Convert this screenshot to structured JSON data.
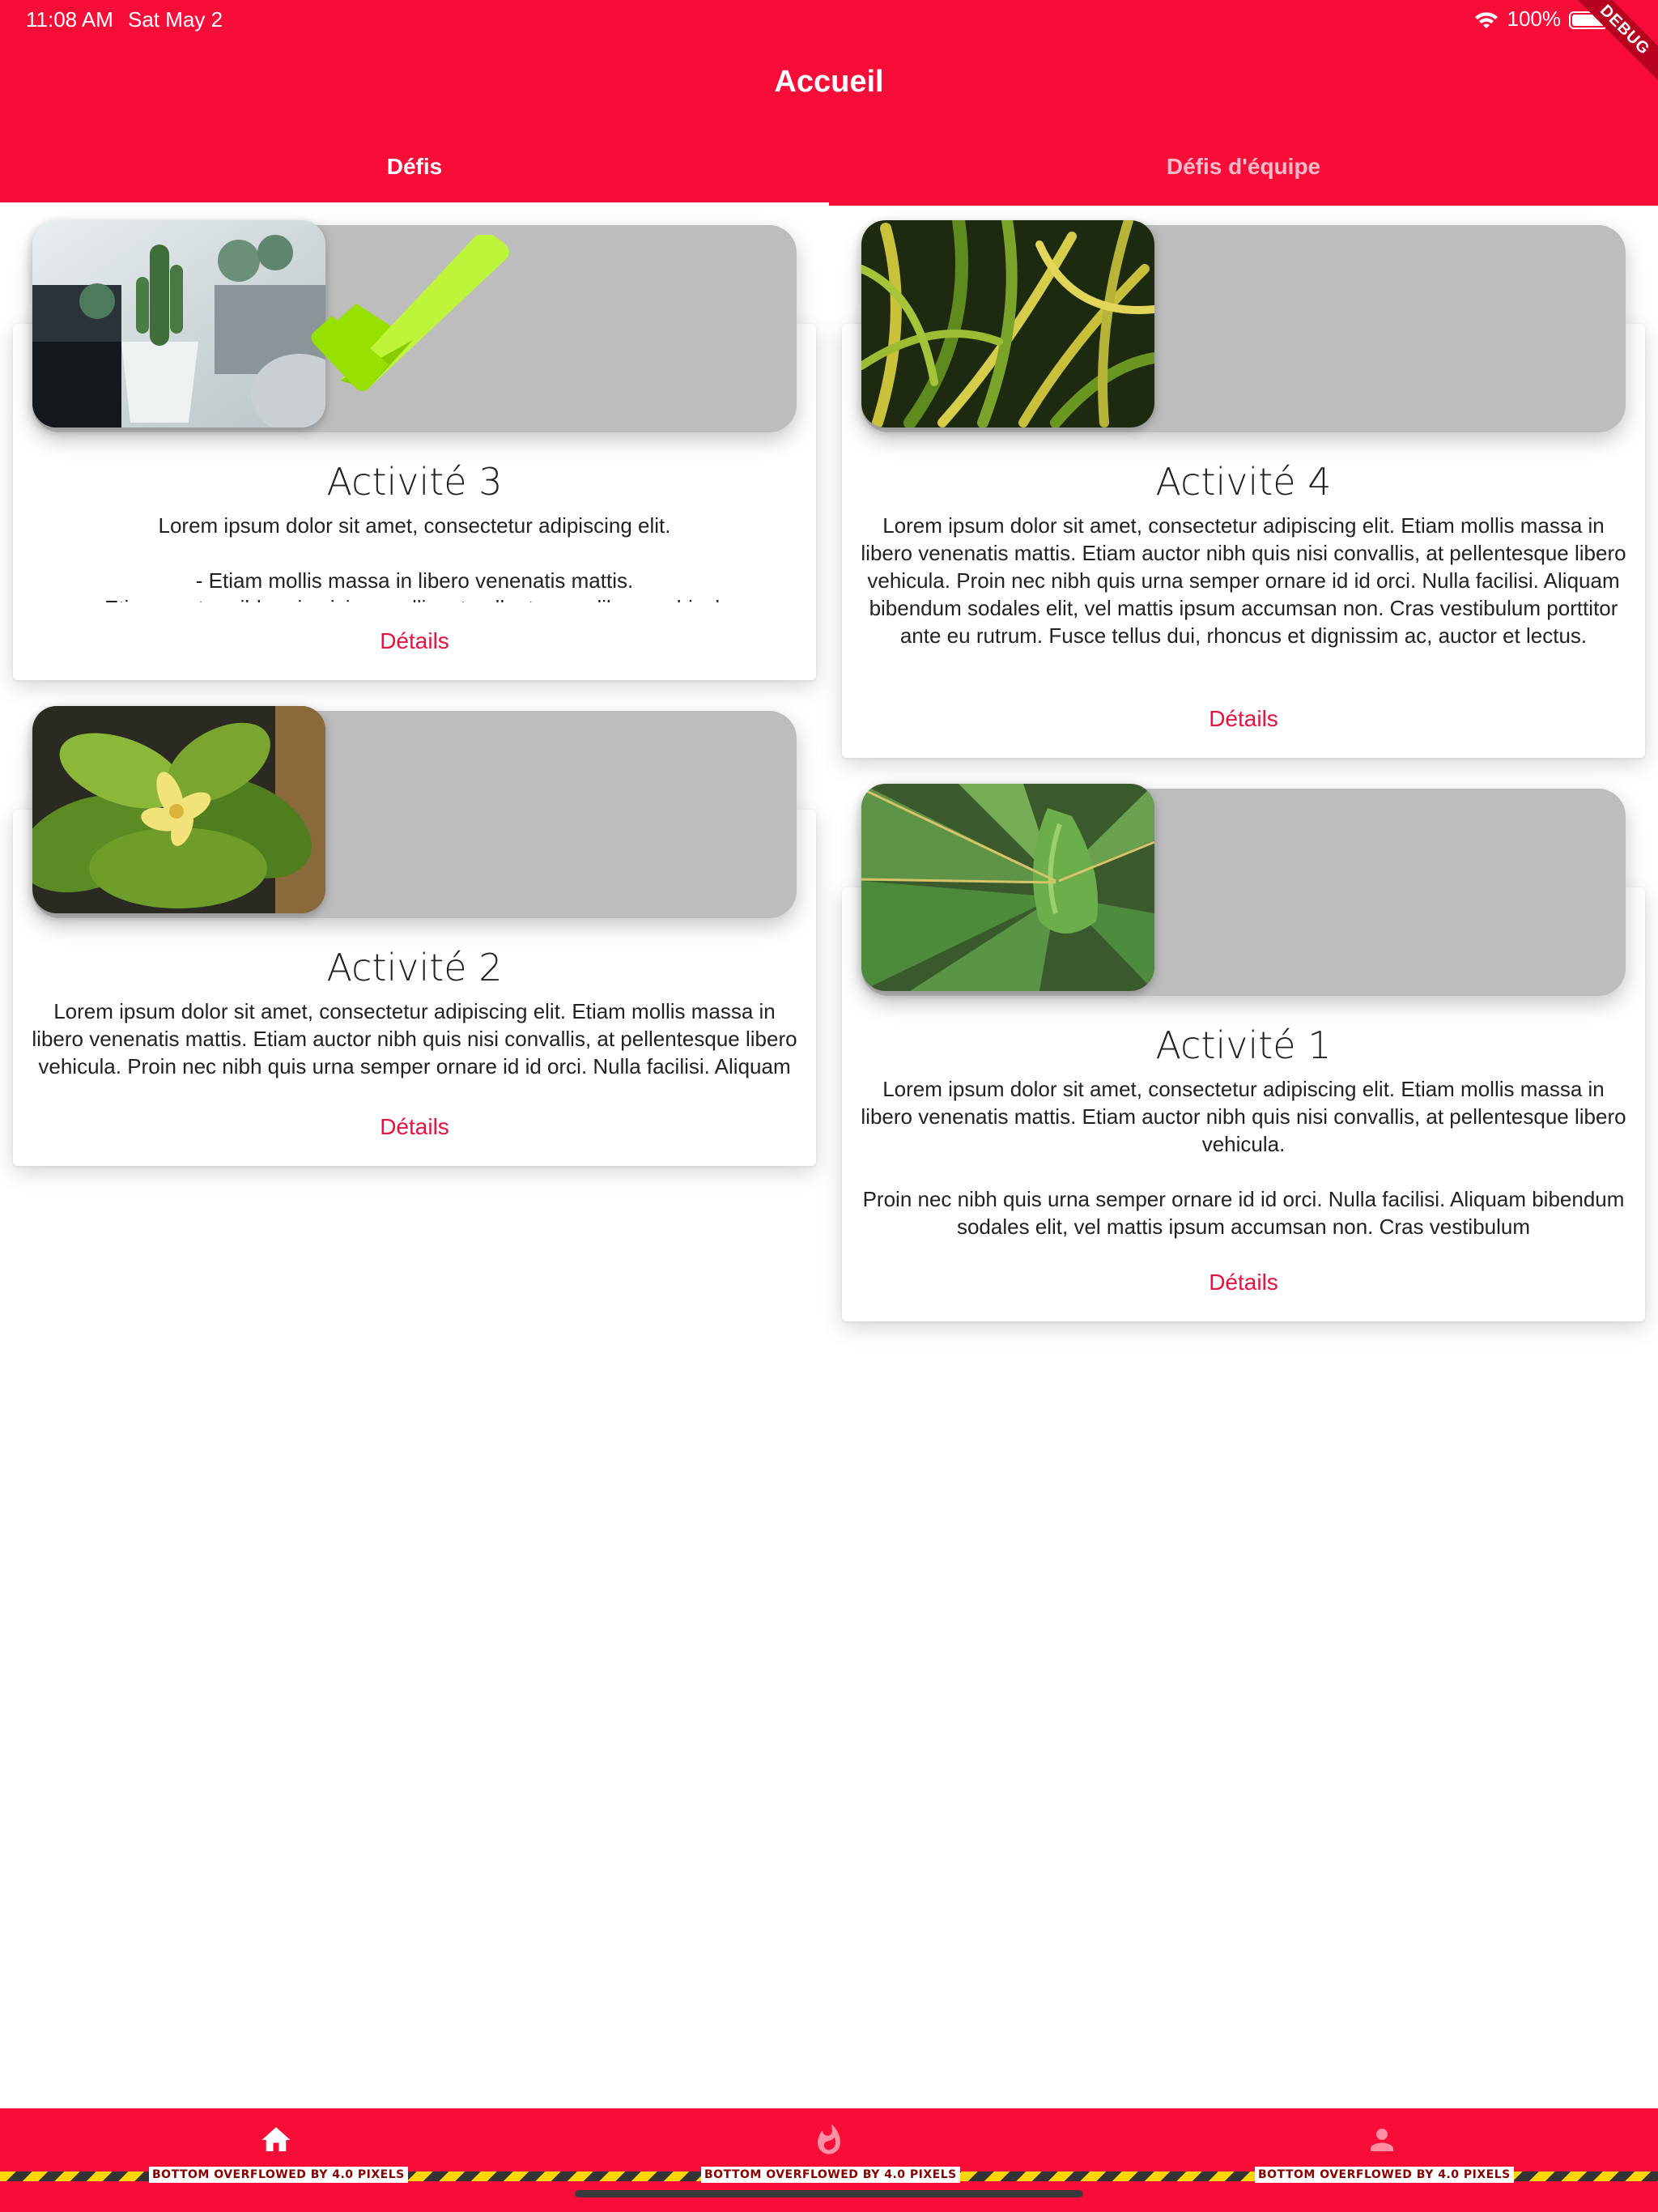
{
  "status_bar": {
    "time": "11:08 AM",
    "date": "Sat May 2",
    "battery": "100%",
    "debug_label": "DEBUG"
  },
  "header": {
    "title": "Accueil"
  },
  "tabs": [
    {
      "label": "Défis",
      "active": true
    },
    {
      "label": "Défis d'équipe",
      "active": false
    }
  ],
  "colors": {
    "primary": "#f80d39",
    "link": "#e8103c",
    "check": "#a4e000"
  },
  "cards": [
    {
      "title": "Activité 3",
      "description": "Lorem ipsum dolor sit amet, consectetur adipiscing elit.\n\n-  Etiam mollis massa in libero venenatis mattis.\n-  Etiam auctor nibh quis nisi convallis, at pellentesque libero vehicula.",
      "link": "Détails",
      "completed": true,
      "image": "cactus-succulents-photo"
    },
    {
      "title": "Activité 4",
      "description": "Lorem ipsum dolor sit amet, consectetur adipiscing elit. Etiam mollis massa in libero venenatis mattis. Etiam auctor nibh quis nisi convallis, at pellentesque libero vehicula. Proin nec nibh quis urna semper ornare id id orci. Nulla facilisi. Aliquam bibendum sodales elit, vel mattis ipsum accumsan non. Cras vestibulum porttitor ante eu rutrum. Fusce tellus dui, rhoncus et dignissim ac, auctor et lectus.",
      "link": "Détails",
      "completed": false,
      "image": "striped-grass-photo"
    },
    {
      "title": "Activité 2",
      "description": "Lorem ipsum dolor sit amet, consectetur adipiscing elit. Etiam mollis massa in libero venenatis mattis. Etiam auctor nibh quis nisi convallis, at pellentesque libero vehicula. Proin nec nibh quis urna semper ornare id id orci. Nulla facilisi. Aliquam bibendum sodales elit, vel mattis ipsum accumsan non.",
      "link": "Détails",
      "completed": false,
      "image": "green-plant-yellow-flower-photo"
    },
    {
      "title": "Activité 1",
      "description": "Lorem ipsum dolor sit amet, consectetur adipiscing elit. Etiam mollis massa in libero venenatis mattis. Etiam auctor nibh quis nisi convallis, at pellentesque libero vehicula.\n\nProin nec nibh quis urna semper ornare id id orci. Nulla facilisi. Aliquam bibendum sodales elit, vel mattis ipsum accumsan non. Cras vestibulum",
      "link": "Détails",
      "completed": false,
      "image": "agave-photo"
    }
  ],
  "bottom_nav": {
    "items": [
      {
        "icon": "home-icon"
      },
      {
        "icon": "flame-icon"
      },
      {
        "icon": "person-icon"
      }
    ],
    "overflow_label": "BOTTOM OVERFLOWED BY 4.0 PIXELS"
  }
}
